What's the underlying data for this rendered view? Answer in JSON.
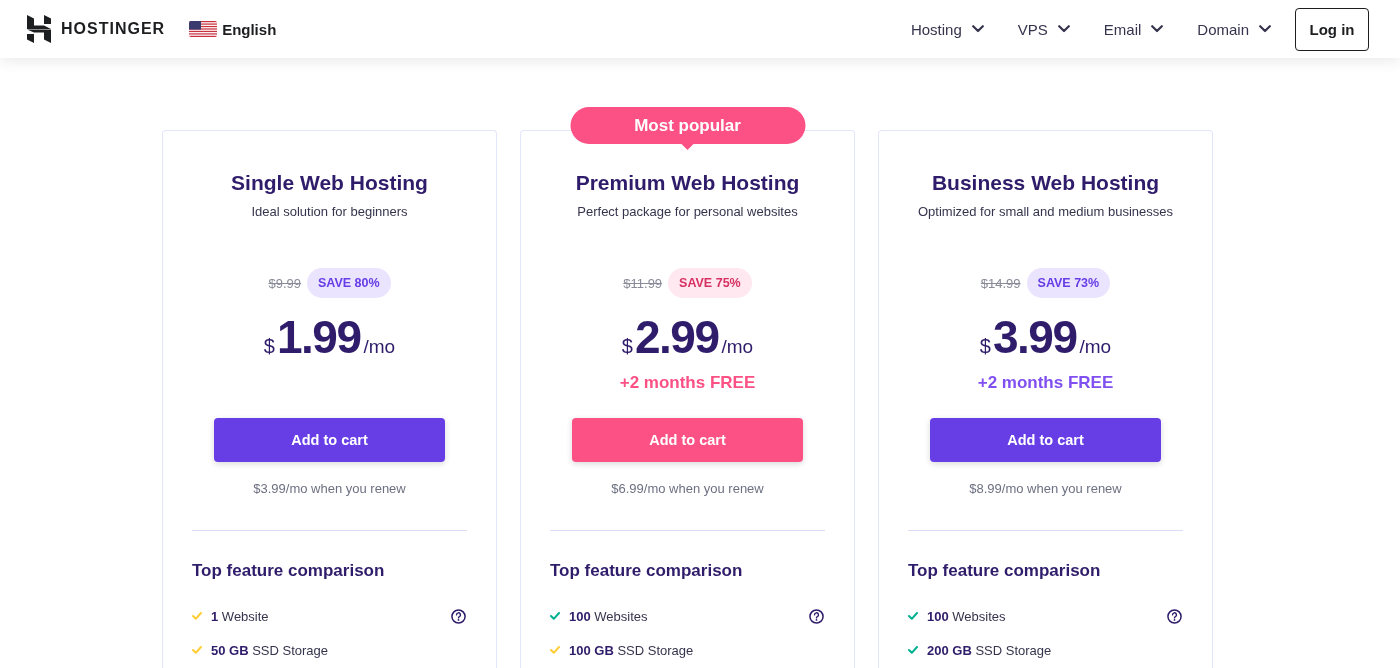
{
  "header": {
    "logo_text": "HOSTINGER",
    "language": "English",
    "nav": [
      "Hosting",
      "VPS",
      "Email",
      "Domain"
    ],
    "login": "Log in"
  },
  "plans": [
    {
      "featured": false,
      "title": "Single Web Hosting",
      "subtitle": "Ideal solution for beginners",
      "old_price": "$9.99",
      "discount": "SAVE 80%",
      "price": {
        "currency": "$",
        "amount": "1.99",
        "period": "/mo"
      },
      "cta": "Add to cart",
      "renewal": "$3.99/mo when you renew",
      "features_heading": "Top feature comparison",
      "features": [
        {
          "text": "**1** Website",
          "color": "#ffcd35",
          "help": true
        },
        {
          "text": "**50 GB** SSD Storage",
          "color": "#ffcd35",
          "help": false
        }
      ]
    },
    {
      "featured": true,
      "badge": "Most popular",
      "title": "Premium Web Hosting",
      "subtitle": "Perfect package for personal websites",
      "old_price": "$11.99",
      "discount": "SAVE 75%",
      "price": {
        "currency": "$",
        "amount": "2.99",
        "period": "/mo"
      },
      "bonus": "+2 months FREE",
      "cta": "Add to cart",
      "renewal": "$6.99/mo when you renew",
      "features_heading": "Top feature comparison",
      "features": [
        {
          "text": "**100** Websites",
          "color": "#00b090",
          "help": true
        },
        {
          "text": "**100 GB** SSD Storage",
          "color": "#ffcd35",
          "help": false
        }
      ]
    },
    {
      "featured": false,
      "title": "Business Web Hosting",
      "subtitle": "Optimized for small and medium businesses",
      "old_price": "$14.99",
      "discount": "SAVE 73%",
      "price": {
        "currency": "$",
        "amount": "3.99",
        "period": "/mo"
      },
      "bonus": "+2 months FREE",
      "cta": "Add to cart",
      "renewal": "$8.99/mo when you renew",
      "features_heading": "Top feature comparison",
      "features": [
        {
          "text": "**100** Websites",
          "color": "#00b090",
          "help": true
        },
        {
          "text": "**200 GB** SSD Storage",
          "color": "#00b090",
          "help": false
        }
      ]
    }
  ]
}
